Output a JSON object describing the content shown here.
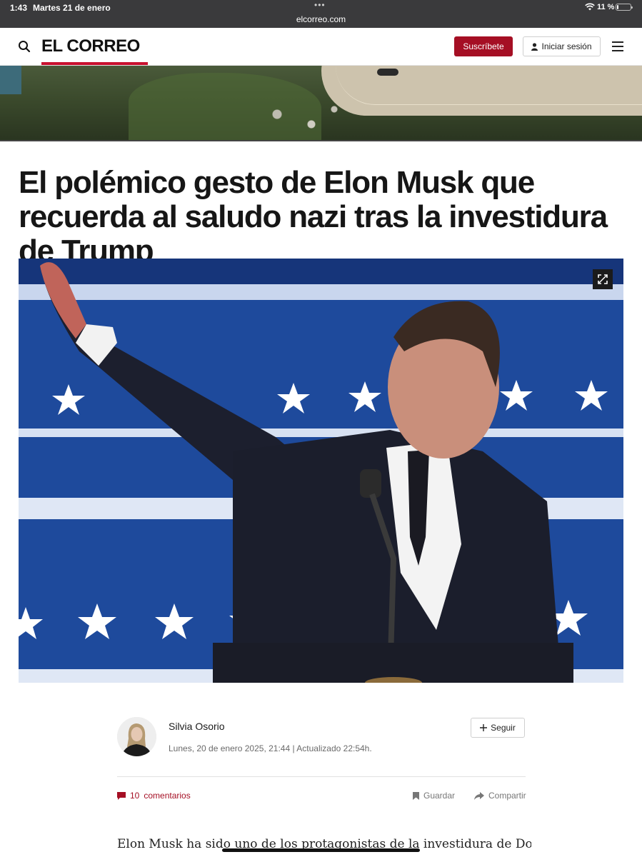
{
  "status_bar": {
    "time": "1:43",
    "date": "Martes 21 de enero",
    "url": "elcorreo.com",
    "battery": "11 %",
    "battery_level": 0.11
  },
  "header": {
    "logo": "EL CORREO",
    "subscribe_label": "Suscríbete",
    "login_label": "Iniciar sesión",
    "brand_color": "#c8102e",
    "button_color": "#a50f24"
  },
  "article": {
    "headline": "El polémico gesto de Elon Musk que recuerda al saludo nazi tras la investidura de Trump",
    "author": {
      "name": "Silvia Osorio",
      "date": "Lunes, 20 de enero 2025, 21:44 | Actualizado 22:54h.",
      "follow_label": "Seguir"
    },
    "actions": {
      "comments_count": "10",
      "comments_label": "comentarios",
      "save_label": "Guardar",
      "share_label": "Compartir"
    },
    "lead": "Elon Musk ha sido uno de los protagonistas de la investidura de Donald"
  },
  "icons": {
    "search": "search-icon",
    "menu": "menu-icon",
    "user": "user-icon",
    "expand": "expand-icon",
    "plus": "plus-icon",
    "comment": "comment-icon",
    "bookmark": "bookmark-icon",
    "share": "share-icon",
    "wifi": "wifi-icon",
    "battery": "battery-icon"
  }
}
